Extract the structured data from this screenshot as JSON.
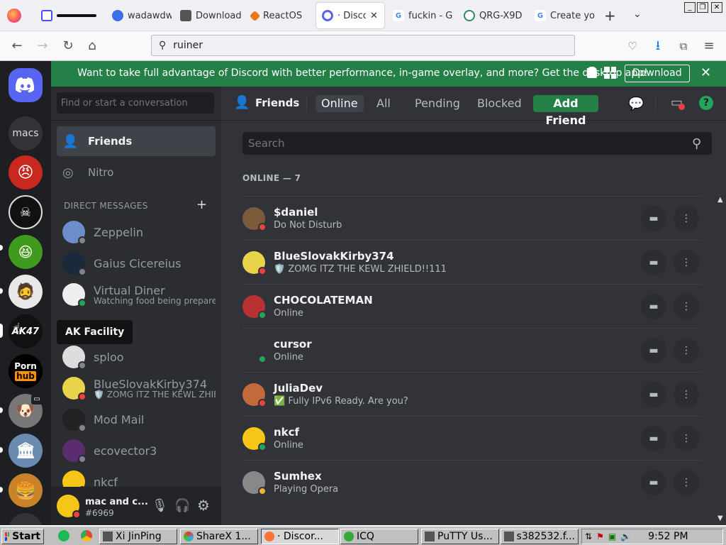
{
  "browser": {
    "tabs": [
      {
        "label": "",
        "fav": "#4a4aff",
        "icon": "window-icon"
      },
      {
        "label": "wadawdw",
        "fav": "#3b6ee8",
        "icon": "edge-icon"
      },
      {
        "label": "Download",
        "fav": "#444",
        "icon": "putty-icon"
      },
      {
        "label": "ReactOS",
        "fav": "#e87a1d",
        "icon": "reactos-icon"
      },
      {
        "label": "· Discor",
        "fav": "#5865f2",
        "icon": "discord-tab-icon"
      },
      {
        "label": "fuckin - G",
        "fav": "#4285f4",
        "icon": "google-icon"
      },
      {
        "label": "QRG-X9D",
        "fav": "#2a8a6a",
        "icon": "qr-icon"
      },
      {
        "label": "Create yo",
        "fav": "#4285f4",
        "icon": "google-icon"
      }
    ],
    "url": "ruiner"
  },
  "banner": {
    "text": "Want to take full advantage of Discord with better performance, in-game overlay, and more? Get the desktop app!",
    "button": "Download"
  },
  "servers": [
    {
      "label": "",
      "color": "#5865f2",
      "name": "home"
    },
    {
      "label": "macs",
      "color": "#313338",
      "name": "macs"
    },
    {
      "label": "",
      "color": "#c8281e",
      "name": "server-red"
    },
    {
      "label": "",
      "color": "#111",
      "name": "server-dark"
    },
    {
      "label": "",
      "color": "#3f9a1d",
      "name": "server-troll"
    },
    {
      "label": "",
      "color": "#e8e8e8",
      "name": "server-peter"
    },
    {
      "label": "",
      "color": "#111",
      "name": "server-ak47"
    },
    {
      "label": "Porn hub",
      "color": "#000",
      "name": "server-hub"
    },
    {
      "label": "",
      "color": "#777",
      "name": "server-dog"
    },
    {
      "label": "",
      "color": "#6a8ab0",
      "name": "server-palace"
    },
    {
      "label": "",
      "color": "#c8822a",
      "name": "server-burger"
    }
  ],
  "tooltip": "AK Facility",
  "dm": {
    "search_placeholder": "Find or start a conversation",
    "friends": "Friends",
    "nitro": "Nitro",
    "section": "DIRECT MESSAGES",
    "items": [
      {
        "name": "Zeppelin",
        "sub": "",
        "color": "#6c8ec9",
        "status": "off"
      },
      {
        "name": "Gaius Cicereius",
        "sub": "",
        "color": "#1b2a3a",
        "status": "off"
      },
      {
        "name": "Virtual Diner",
        "sub": "Watching food being prepared!",
        "color": "#eee",
        "status": "online"
      },
      {
        "name": "sploo",
        "sub": "",
        "color": "#ddd",
        "status": "off"
      },
      {
        "name": "BlueSlovakKirby374",
        "sub": "🛡️ ZOMG ITZ THE KEWL ZHIE...",
        "color": "#e8d34a",
        "status": "dnd"
      },
      {
        "name": "Mod Mail",
        "sub": "",
        "color": "#222",
        "status": "off"
      },
      {
        "name": "ecovector3",
        "sub": "",
        "color": "#5b2d6e",
        "status": "off"
      },
      {
        "name": "nkcf",
        "sub": "",
        "color": "#f5c518",
        "status": "off"
      }
    ],
    "user": {
      "name": "mac and c...",
      "tag": "#6969"
    }
  },
  "header": {
    "friends": "Friends",
    "tabs": [
      "Online",
      "All",
      "Pending",
      "Blocked"
    ],
    "add": "Add Friend"
  },
  "main": {
    "search_placeholder": "Search",
    "count_label": "ONLINE — 7",
    "friends": [
      {
        "name": "$daniel",
        "status_text": "Do Not Disturb",
        "color": "#7a5b3a",
        "status": "dnd"
      },
      {
        "name": "BlueSlovakKirby374",
        "status_text": "🛡️ ZOMG ITZ THE KEWL ZHIELD!!111",
        "color": "#e8d34a",
        "status": "dnd"
      },
      {
        "name": "CHOCOLATEMAN",
        "status_text": "Online",
        "color": "#b93232",
        "status": "online"
      },
      {
        "name": "cursor",
        "status_text": "Online",
        "color": "#313338",
        "status": "online"
      },
      {
        "name": "JuliaDev",
        "status_text": "✅ Fully IPv6 Ready. Are you?",
        "color": "#c26a3a",
        "status": "dnd"
      },
      {
        "name": "nkcf",
        "status_text": "Online",
        "color": "#f5c518",
        "status": "online"
      },
      {
        "name": "Sumhex",
        "status_text": "Playing Opera",
        "color": "#888",
        "status": "idle"
      }
    ]
  },
  "taskbar": {
    "start": "Start",
    "items": [
      "Xi JinPing",
      "ShareX 1...",
      "· Discor...",
      "ICQ",
      "PuTTY Us...",
      "s382532.f..."
    ],
    "clock": "9:52 PM"
  }
}
